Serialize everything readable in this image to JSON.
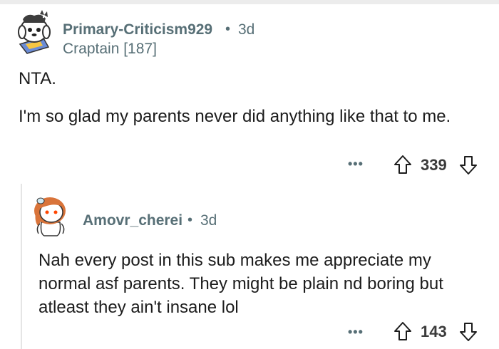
{
  "comment": {
    "username": "Primary-Criticism929",
    "separator": "•",
    "age": "3d",
    "flair": "Craptain [187]",
    "paragraphs": [
      "NTA.",
      "I'm so glad my parents never did anything like that to me."
    ],
    "more_label": "•••",
    "score": "339"
  },
  "reply": {
    "username": "Amovr_cherei",
    "separator": "•",
    "age": "3d",
    "text": "Nah every post in this sub makes me appreciate my normal asf parents. They might be plain nd boring but atleast they ain't insane lol",
    "more_label": "•••",
    "score": "143"
  },
  "icons": {
    "upvote": "arrow-up-icon",
    "downvote": "arrow-down-icon",
    "more": "ellipsis-icon"
  },
  "colors": {
    "meta": "#576f76",
    "text": "#1c1c1c",
    "thread_line": "#e5e5e5"
  }
}
